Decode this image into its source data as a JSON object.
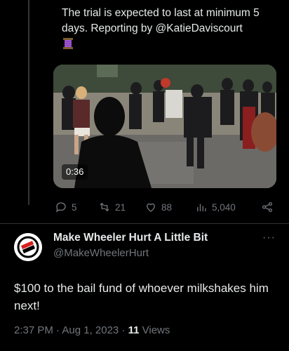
{
  "previous_tweet": {
    "text": "The trial is expected to last at minimum 5 days. Reporting by @KatieDaviscourt",
    "emoji": "spool-of-thread",
    "video": {
      "duration": "0:36"
    },
    "actions": {
      "replies": "5",
      "retweets": "21",
      "likes": "88",
      "views": "5,040"
    }
  },
  "tweet": {
    "display_name": "Make Wheeler Hurt A Little Bit",
    "handle": "@MakeWheelerHurt",
    "more": "···",
    "text": "$100 to the bail fund of whoever milkshakes him next!",
    "time": "2:37 PM · Aug 1, 2023 · ",
    "views_count": "11",
    "views_label": " Views"
  },
  "colors": {
    "background": "#000000",
    "text": "#e7e9ea",
    "muted": "#71767b",
    "divider": "#2f3336",
    "avatar_red": "#d9201f"
  }
}
